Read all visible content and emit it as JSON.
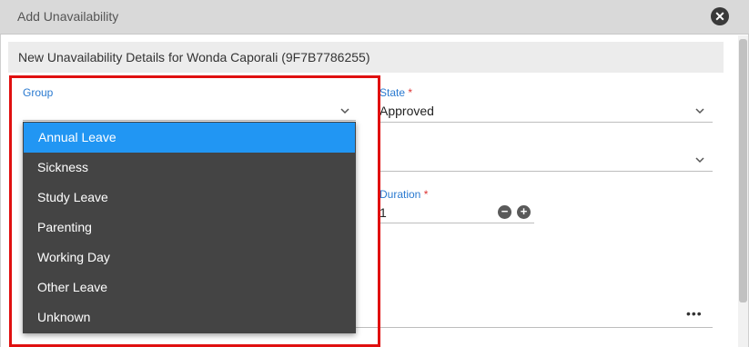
{
  "dialog": {
    "title": "Add Unavailability",
    "section_header": "New Unavailability Details for Wonda Caporali (9F7B7786255)"
  },
  "form": {
    "group": {
      "label": "Group",
      "value": ""
    },
    "state": {
      "label": "State",
      "required_mark": "*",
      "value": "Approved"
    },
    "duration": {
      "label": "Duration",
      "required_mark": "*",
      "value": "1",
      "decrement_icon": "minus-circle-icon",
      "increment_icon": "plus-circle-icon"
    },
    "more_icon": "more-horizontal-icon",
    "more_label": "•••"
  },
  "group_dropdown": {
    "options": [
      "Annual Leave",
      "Sickness",
      "Study Leave",
      "Parenting",
      "Working Day",
      "Other Leave",
      "Unknown"
    ],
    "selected": "Annual Leave"
  },
  "colors": {
    "accent": "#2196f3",
    "highlight_border": "#e01010",
    "dropdown_bg": "#444444"
  }
}
